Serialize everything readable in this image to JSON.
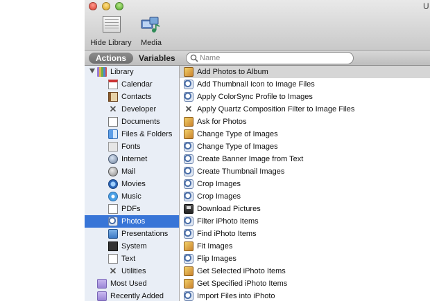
{
  "window": {
    "title": "U"
  },
  "toolbar": {
    "hide_library_label": "Hide Library",
    "media_label": "Media"
  },
  "filter": {
    "actions_label": "Actions",
    "variables_label": "Variables",
    "search_placeholder": "Name",
    "search_value": ""
  },
  "library": {
    "items": [
      {
        "label": "Library",
        "icon": "library-icon"
      },
      {
        "label": "Calendar",
        "icon": "calendar-icon"
      },
      {
        "label": "Contacts",
        "icon": "contacts-icon"
      },
      {
        "label": "Developer",
        "icon": "developer-icon"
      },
      {
        "label": "Documents",
        "icon": "documents-icon"
      },
      {
        "label": "Files & Folders",
        "icon": "files-folders-icon"
      },
      {
        "label": "Fonts",
        "icon": "fonts-icon"
      },
      {
        "label": "Internet",
        "icon": "internet-icon"
      },
      {
        "label": "Mail",
        "icon": "mail-icon"
      },
      {
        "label": "Movies",
        "icon": "movies-icon"
      },
      {
        "label": "Music",
        "icon": "music-icon"
      },
      {
        "label": "PDFs",
        "icon": "pdfs-icon"
      },
      {
        "label": "Photos",
        "icon": "photos-icon"
      },
      {
        "label": "Presentations",
        "icon": "presentations-icon"
      },
      {
        "label": "System",
        "icon": "system-icon"
      },
      {
        "label": "Text",
        "icon": "text-icon"
      },
      {
        "label": "Utilities",
        "icon": "utilities-icon"
      },
      {
        "label": "Most Used",
        "icon": "smart-folder-icon"
      },
      {
        "label": "Recently Added",
        "icon": "smart-folder-icon"
      }
    ]
  },
  "actions": {
    "items": [
      {
        "label": "Add Photos to Album",
        "icon": "photo-action-icon"
      },
      {
        "label": "Add Thumbnail Icon to Image Files",
        "icon": "preview-action-icon"
      },
      {
        "label": "Apply ColorSync Profile to Images",
        "icon": "preview-action-icon"
      },
      {
        "label": "Apply Quartz Composition Filter to Image Files",
        "icon": "quartz-action-icon"
      },
      {
        "label": "Ask for Photos",
        "icon": "photo-action-icon"
      },
      {
        "label": "Change Type of Images",
        "icon": "photo-action-icon"
      },
      {
        "label": "Change Type of Images",
        "icon": "preview-action-icon"
      },
      {
        "label": "Create Banner Image from Text",
        "icon": "preview-action-icon"
      },
      {
        "label": "Create Thumbnail Images",
        "icon": "preview-action-icon"
      },
      {
        "label": "Crop Images",
        "icon": "preview-action-icon"
      },
      {
        "label": "Crop Images",
        "icon": "preview-action-icon"
      },
      {
        "label": "Download Pictures",
        "icon": "download-action-icon"
      },
      {
        "label": "Filter iPhoto Items",
        "icon": "preview-action-icon"
      },
      {
        "label": "Find iPhoto Items",
        "icon": "preview-action-icon"
      },
      {
        "label": "Fit Images",
        "icon": "photo-action-icon"
      },
      {
        "label": "Flip Images",
        "icon": "preview-action-icon"
      },
      {
        "label": "Get Selected iPhoto Items",
        "icon": "photo-action-icon"
      },
      {
        "label": "Get Specified iPhoto Items",
        "icon": "photo-action-icon"
      },
      {
        "label": "Import Files into iPhoto",
        "icon": "preview-action-icon"
      }
    ]
  },
  "colors": {
    "selection": "#3875d7",
    "library_bg": "#e9eef6",
    "action_selected": "#d6d6d6"
  }
}
